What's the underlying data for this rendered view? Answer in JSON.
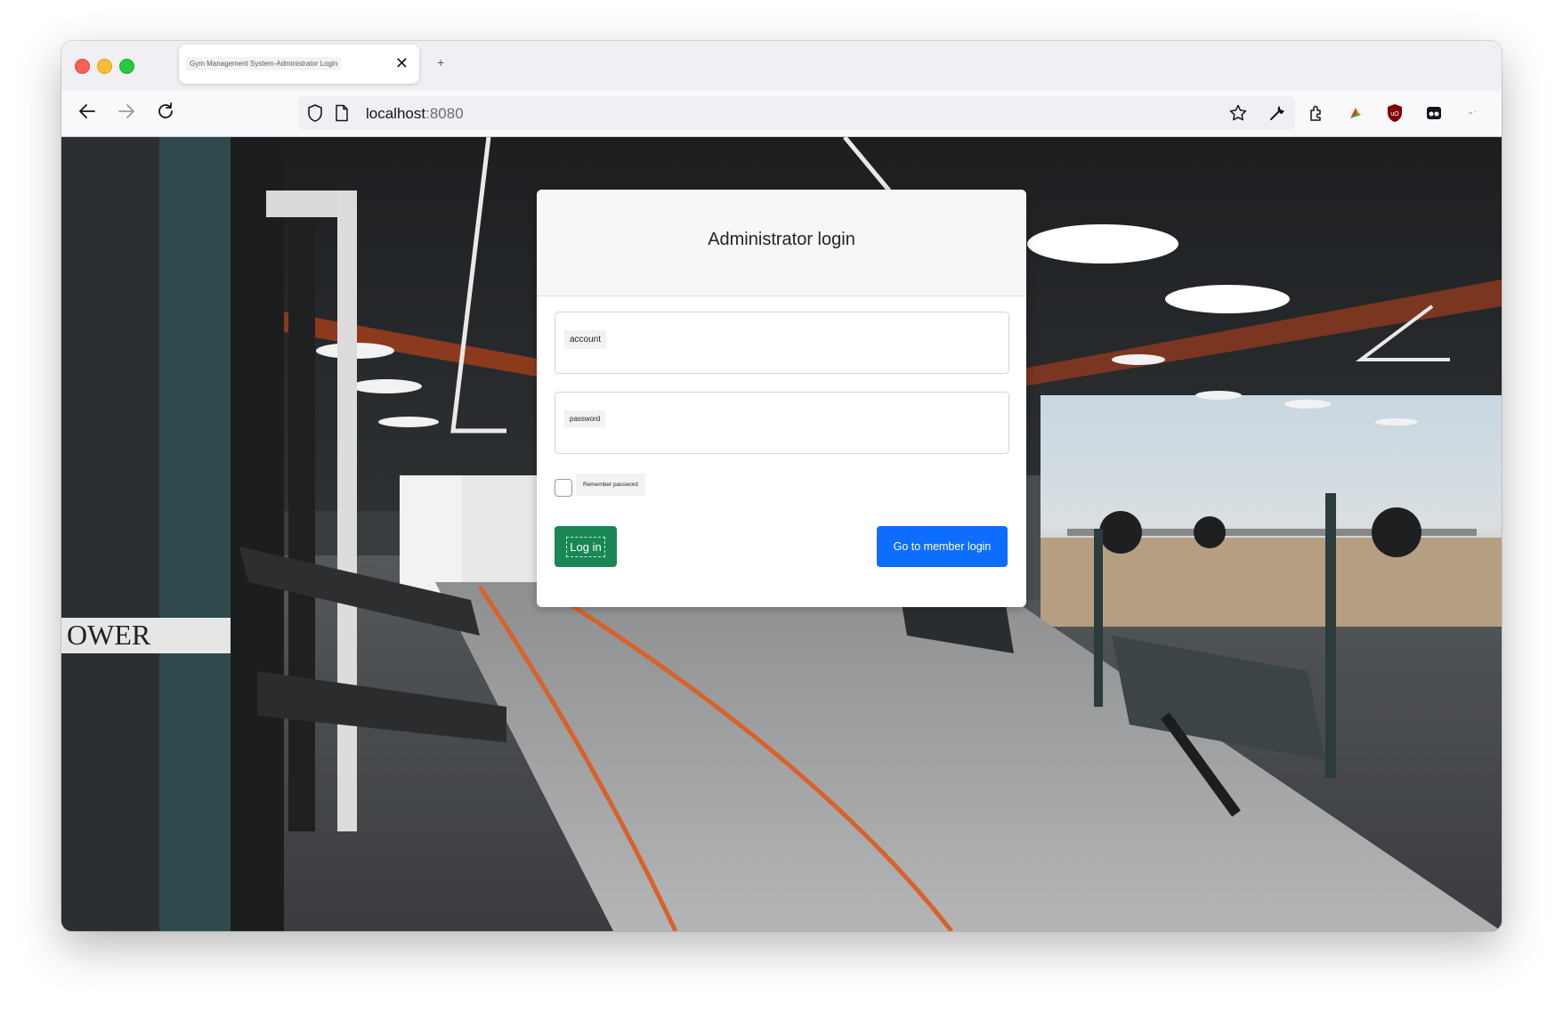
{
  "browser": {
    "tab_title": "Gym Management System-Administrator Login",
    "new_tab_label": "+",
    "url_host": "localhost",
    "url_port": ":8080"
  },
  "login": {
    "title": "Administrator login",
    "account_label": "account",
    "password_label": "password",
    "remember_label": "Remember password",
    "login_button": "Log in",
    "member_button": "Go to member login"
  },
  "background": {
    "sign_text": "OWER"
  },
  "colors": {
    "login_button": "#198754",
    "member_button": "#0d6efd"
  }
}
